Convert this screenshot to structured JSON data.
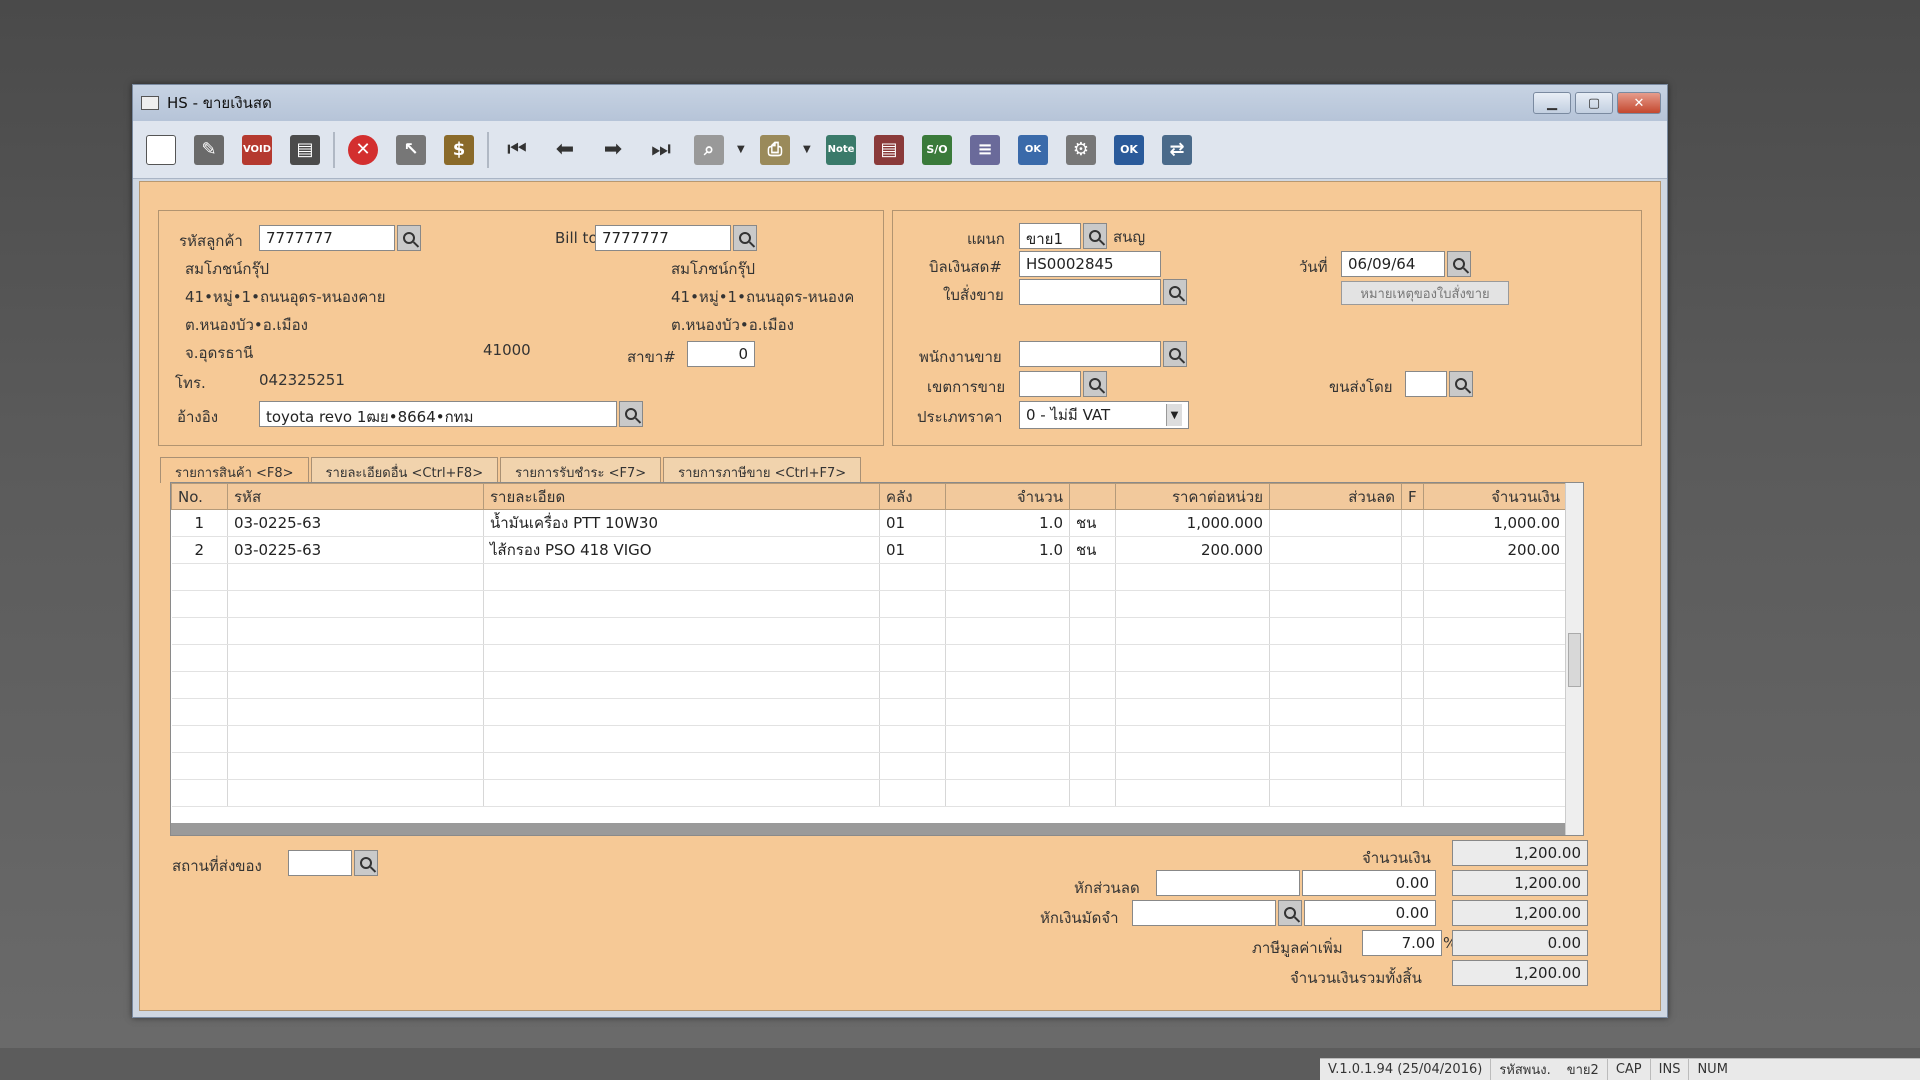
{
  "window": {
    "title": "HS - ขายเงินสด"
  },
  "toolbar": {
    "icons": [
      "new-document-icon",
      "edit-icon",
      "void-icon",
      "delete-trash-icon",
      "cancel-icon",
      "select-icon",
      "money-icon",
      "first-record-icon",
      "previous-record-icon",
      "next-record-icon",
      "last-record-icon",
      "find-icon",
      "print-icon",
      "note-icon",
      "list-icon",
      "so-icon",
      "list-icon",
      "approve-ok-icon",
      "tools-icon",
      "ok-icon",
      "transfer-icon"
    ]
  },
  "customer": {
    "code_label": "รหัสลูกค้า",
    "code_value": "7777777",
    "billto_label": "Bill to",
    "billto_value": "7777777",
    "name": "สมโภชน์กรุ๊ป",
    "address1": "41•หมู่•1•ถนนอุดร-หนองคาย",
    "address2": "ต.หนองบัว•อ.เมือง",
    "province": "จ.อุดรธานี",
    "zip": "41000",
    "billto_name": "สมโภชน์กรุ๊ป",
    "billto_address1": "41•หมู่•1•ถนนอุดร-หนองค",
    "billto_address2": "ต.หนองบัว•อ.เมือง",
    "branch_label": "สาขา#",
    "branch_value": "0",
    "phone_label": "โทร.",
    "phone_value": "042325251",
    "ref_label": "อ้างอิง",
    "ref_value": "toyota revo 1ฒย•8664•กทม"
  },
  "doc": {
    "dept_label": "แผนก",
    "dept_value": "ขาย1",
    "dept_name": "สนญ",
    "bill_label": "บิลเงินสด#",
    "bill_value": "HS0002845",
    "date_label": "วันที่",
    "date_value": "06/09/64",
    "so_label": "ใบสั่งขาย",
    "so_value": "",
    "so_note_button": "หมายเหตุของใบสั่งขาย",
    "salesman_label": "พนักงานขาย",
    "salesman_value": "",
    "area_label": "เขตการขาย",
    "area_value": "",
    "ship_label": "ขนส่งโดย",
    "ship_value": "",
    "pricetype_label": "ประเภทราคา",
    "pricetype_value": "0 - ไม่มี VAT"
  },
  "tabs": [
    "รายการสินค้า <F8>",
    "รายละเอียดอื่น <Ctrl+F8>",
    "รายการรับชำระ <F7>",
    "รายการภาษีขาย <Ctrl+F7>"
  ],
  "grid": {
    "headers": [
      "No.",
      "รหัส",
      "รายละเอียด",
      "คลัง",
      "จำนวน",
      "",
      "ราคาต่อหน่วย",
      "ส่วนลด",
      "F",
      "จำนวนเงิน"
    ],
    "rows": [
      [
        "1",
        "03-0225-63",
        "น้ำมันเครื่อง PTT 10W30",
        "01",
        "1.0",
        "ชน",
        "1,000.000",
        "",
        "",
        "1,000.00"
      ],
      [
        "2",
        "03-0225-63",
        "ไส้กรอง PSO 418 VIGO",
        "01",
        "1.0",
        "ชน",
        "200.000",
        "",
        "",
        "200.00"
      ]
    ]
  },
  "footer": {
    "ship_place_label": "สถานที่ส่งของ",
    "ship_place_value": "",
    "amount_label": "จำนวนเงิน",
    "amount_value": "1,200.00",
    "discount_label": "หักส่วนลด",
    "discount_code": "",
    "discount_amount": "0.00",
    "discount_total": "1,200.00",
    "deposit_label": "หักเงินมัดจำ",
    "deposit_code": "",
    "deposit_amount": "0.00",
    "deposit_total": "1,200.00",
    "vat_label": "ภาษีมูลค่าเพิ่ม",
    "vat_rate": "7.00",
    "vat_pct": "%",
    "vat_amount": "0.00",
    "grand_label": "จำนวนเงินรวมทั้งสิ้น",
    "grand_value": "1,200.00"
  },
  "status": {
    "version": "V.1.0.1.94 (25/04/2016)",
    "user_label": "รหัสพนง.",
    "user_value": "ขาย2",
    "cap": "CAP",
    "ins": "INS",
    "num": "NUM"
  }
}
